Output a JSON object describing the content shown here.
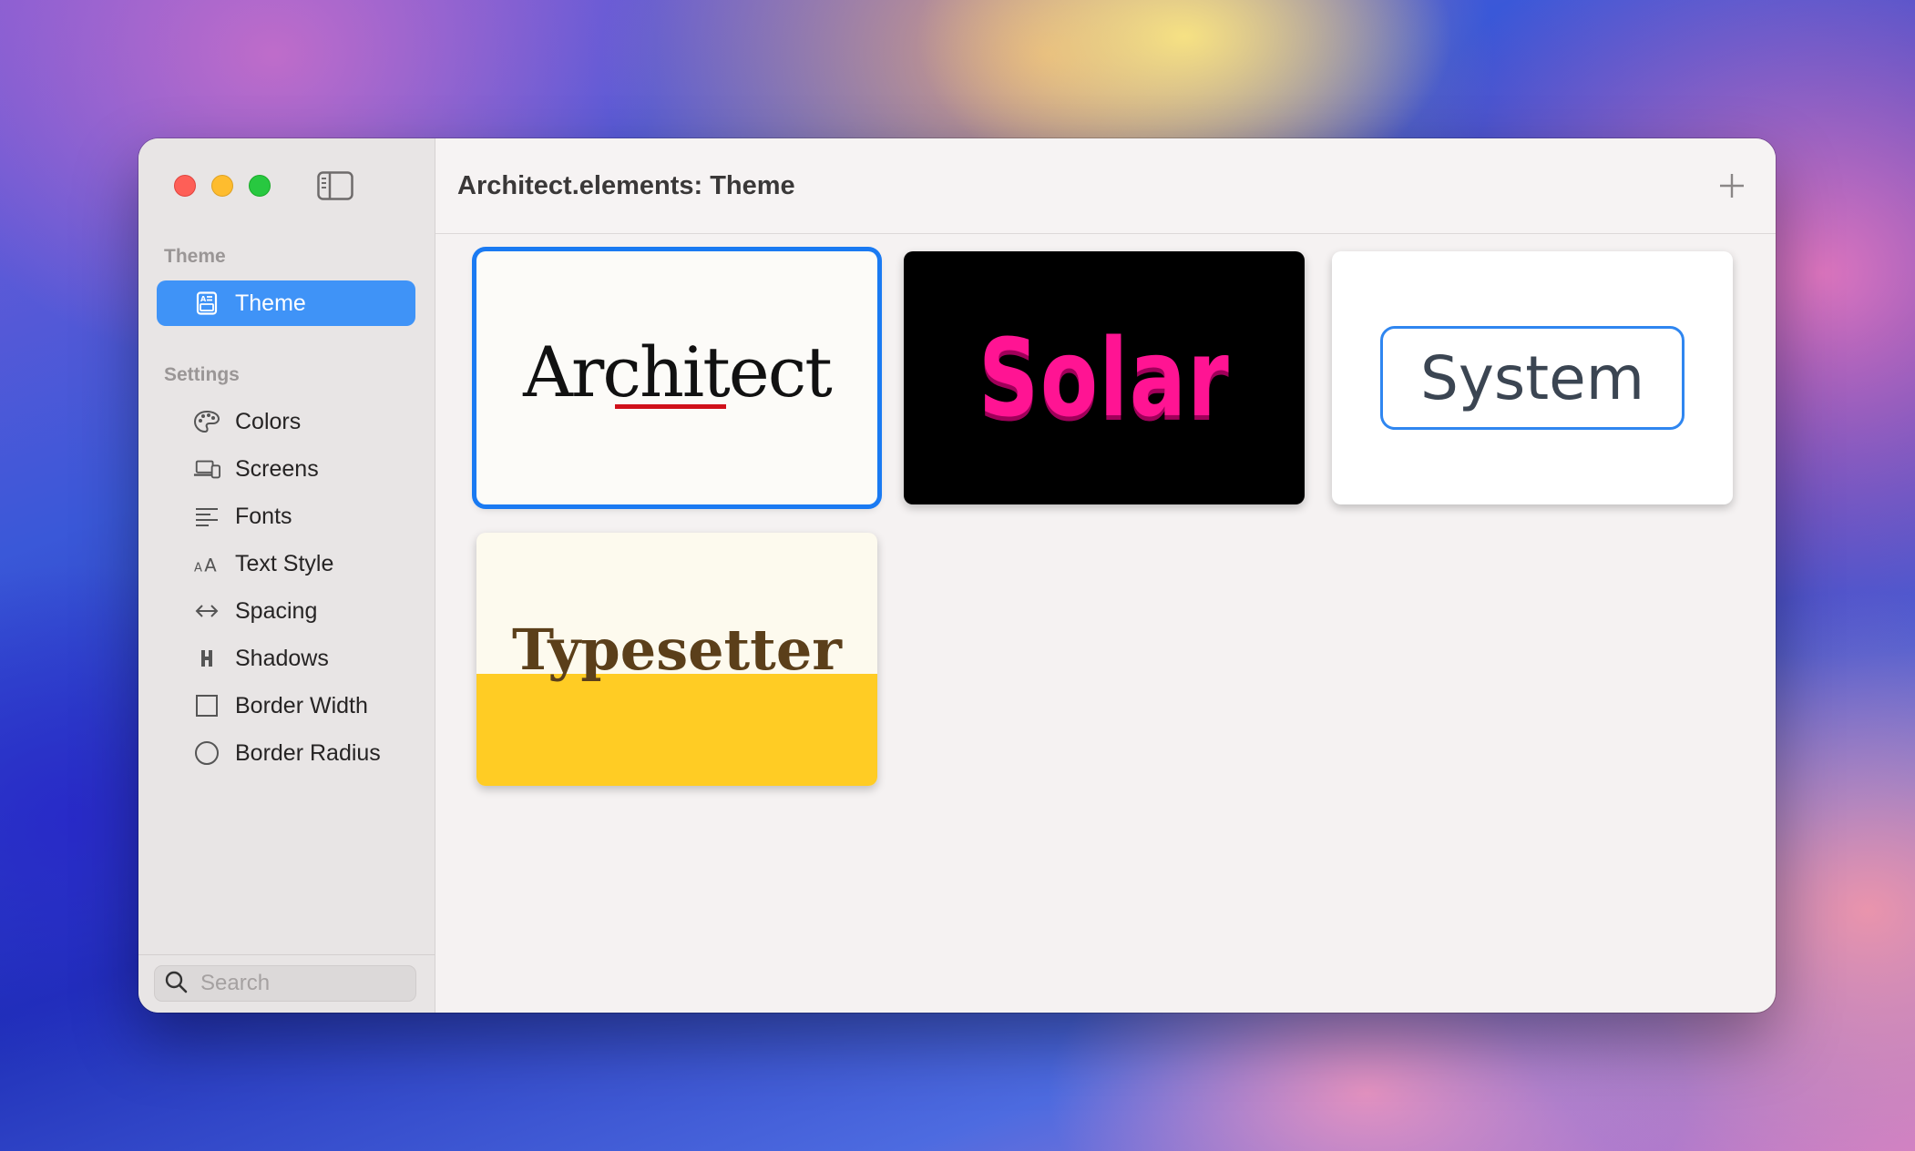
{
  "window": {
    "title": "Architect.elements: Theme"
  },
  "sidebar": {
    "sections": [
      {
        "label": "Theme"
      },
      {
        "label": "Settings"
      }
    ],
    "theme_item": {
      "label": "Theme",
      "icon": "theme-doc-icon"
    },
    "settings_items": [
      {
        "label": "Colors",
        "icon": "palette-icon"
      },
      {
        "label": "Screens",
        "icon": "devices-icon"
      },
      {
        "label": "Fonts",
        "icon": "text-align-icon"
      },
      {
        "label": "Text Style",
        "icon": "text-size-icon"
      },
      {
        "label": "Spacing",
        "icon": "horizontal-arrows-icon"
      },
      {
        "label": "Shadows",
        "icon": "shadow-icon"
      },
      {
        "label": "Border Width",
        "icon": "square-icon"
      },
      {
        "label": "Border Radius",
        "icon": "circle-icon"
      }
    ],
    "search": {
      "placeholder": "Search",
      "value": ""
    }
  },
  "themes": [
    {
      "name": "Architect",
      "selected": true
    },
    {
      "name": "Solar",
      "selected": false
    },
    {
      "name": "System",
      "selected": false
    },
    {
      "name": "Typesetter",
      "selected": false
    }
  ],
  "colors": {
    "accent": "#3f93f7",
    "selection_border": "#1a7af2",
    "solar_pink": "#ff1493",
    "typesetter_yellow": "#ffcc24",
    "architect_red": "#d0101a"
  }
}
